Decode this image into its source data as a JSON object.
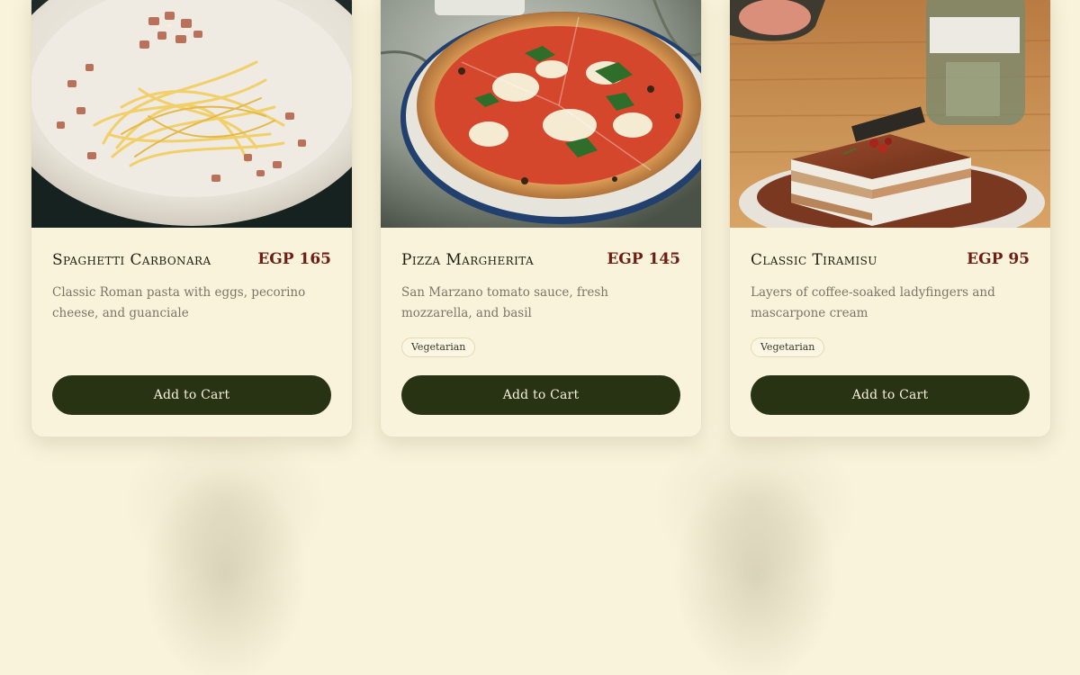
{
  "menu": {
    "items": [
      {
        "name": "Spaghetti Carbonara",
        "price": "EGP 165",
        "description": "Classic Roman pasta with eggs, pecorino cheese, and guanciale",
        "tags": [],
        "button_label": "Add to Cart",
        "image": "spaghetti-carbonara-photo"
      },
      {
        "name": "Pizza Margherita",
        "price": "EGP 145",
        "description": "San Marzano tomato sauce, fresh mozzarella, and basil",
        "tags": [
          "Vegetarian"
        ],
        "button_label": "Add to Cart",
        "image": "pizza-margherita-photo"
      },
      {
        "name": "Classic Tiramisu",
        "price": "EGP 95",
        "description": "Layers of coffee-soaked ladyfingers and mascarpone cream",
        "tags": [
          "Vegetarian"
        ],
        "button_label": "Add to Cart",
        "image": "tiramisu-photo"
      }
    ]
  },
  "colors": {
    "page_background": "#f8f3da",
    "card_background": "#f9f3dc",
    "title_text": "#1d1f10",
    "price_text": "#6e1d14",
    "description_text": "#7b7566",
    "button_background": "#283314",
    "button_text": "#f8f1dc"
  }
}
